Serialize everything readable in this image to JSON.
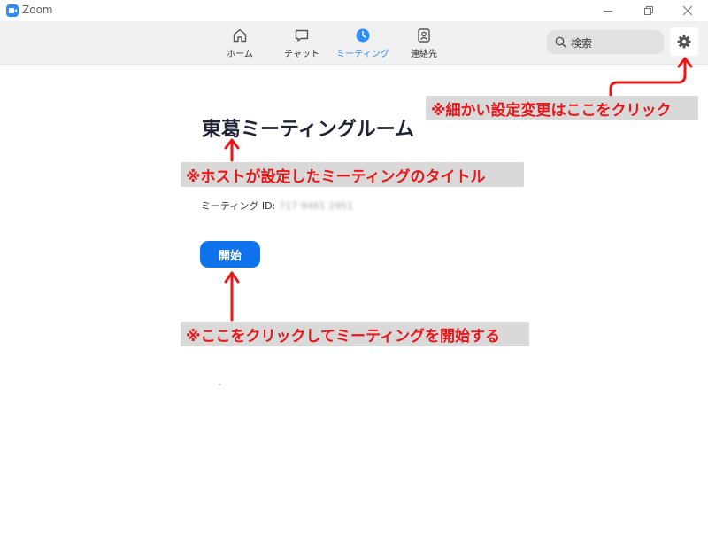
{
  "window": {
    "app_name": "Zoom"
  },
  "tabs": [
    {
      "label": "ホーム",
      "icon": "home-icon",
      "active": false
    },
    {
      "label": "チャット",
      "icon": "chat-icon",
      "active": false
    },
    {
      "label": "ミーティング",
      "icon": "clock-icon",
      "active": true
    },
    {
      "label": "連絡先",
      "icon": "contacts-icon",
      "active": false
    }
  ],
  "search": {
    "label": "検索"
  },
  "settings": {
    "icon": "gear-icon"
  },
  "meeting": {
    "title": "東葛ミーティングルーム",
    "id_label": "ミーティング ID:",
    "id_value": "717 9461 2951",
    "start_label": "開始"
  },
  "annotations": {
    "settings_note": "※細かい設定変更はここをクリック",
    "title_note": "※ホストが設定したミーティングのタイトル",
    "start_note": "※ここをクリックしてミーティングを開始する"
  },
  "colors": {
    "accent": "#2d8cff",
    "start_button": "#0e72ed",
    "annotation_text": "#e8171a",
    "annotation_bg": "#d9d9d9"
  }
}
